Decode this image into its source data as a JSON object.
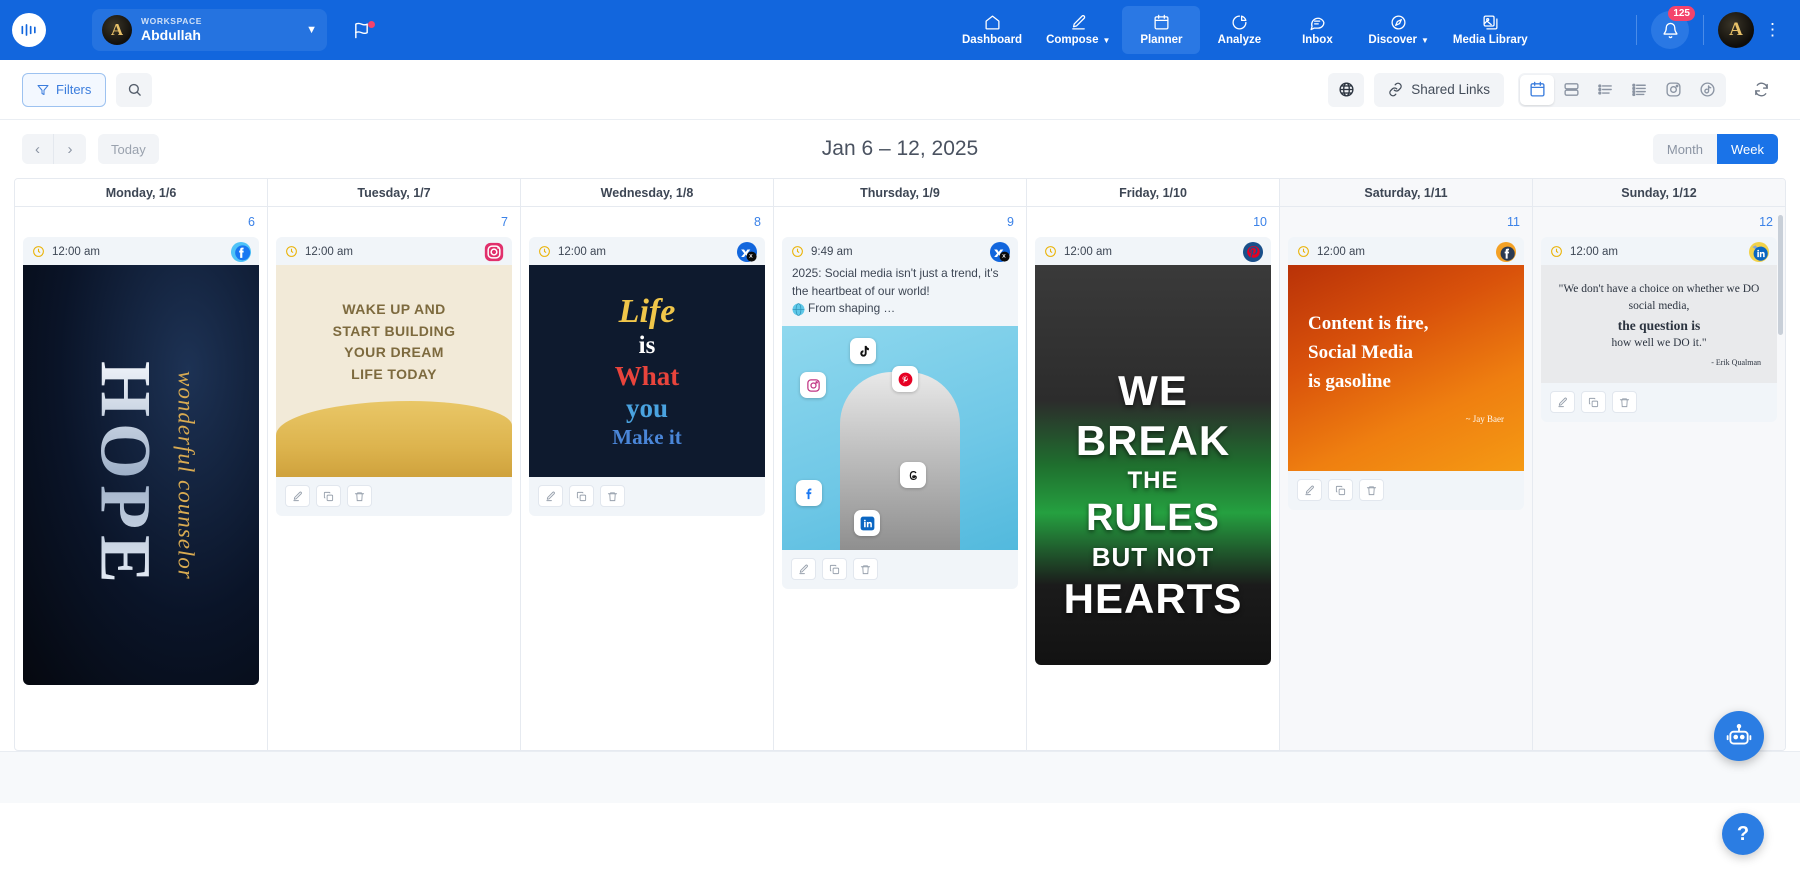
{
  "topnav": {
    "brand_icon": "hootsuite-logo-icon",
    "workspace": {
      "label": "WORKSPACE",
      "name": "Abdullah",
      "avatar_initial": "A",
      "caret_icon": "chevron-down-icon"
    },
    "flag_icon": "flag-icon",
    "items": [
      {
        "label": "Dashboard",
        "icon": "home-icon",
        "active": false,
        "caret": false
      },
      {
        "label": "Compose",
        "icon": "pencil-icon",
        "active": false,
        "caret": true
      },
      {
        "label": "Planner",
        "icon": "calendar-icon",
        "active": true,
        "caret": false
      },
      {
        "label": "Analyze",
        "icon": "pie-chart-icon",
        "active": false,
        "caret": false
      },
      {
        "label": "Inbox",
        "icon": "message-icon",
        "active": false,
        "caret": false
      },
      {
        "label": "Discover",
        "icon": "compass-icon",
        "active": false,
        "caret": true
      },
      {
        "label": "Media Library",
        "icon": "image-stack-icon",
        "active": false,
        "caret": false
      }
    ],
    "notifications": {
      "icon": "bell-icon",
      "count": "125"
    },
    "user_avatar_initial": "A",
    "kebab_icon": "more-vertical-icon"
  },
  "toolbar": {
    "filters_label": "Filters",
    "filters_icon": "filter-icon",
    "search_icon": "search-icon",
    "globe_icon": "globe-icon",
    "shared_links_label": "Shared Links",
    "shared_links_icon": "link-icon",
    "views": [
      {
        "icon": "calendar-view-icon",
        "name": "calendar-view",
        "active": true
      },
      {
        "icon": "split-view-icon",
        "name": "split-view",
        "active": false
      },
      {
        "icon": "list-view-icon",
        "name": "list-view",
        "active": false
      },
      {
        "icon": "detail-list-view-icon",
        "name": "detail-list-view",
        "active": false
      },
      {
        "icon": "instagram-icon",
        "name": "instagram-view",
        "active": false
      },
      {
        "icon": "tiktok-icon",
        "name": "tiktok-view",
        "active": false
      }
    ],
    "refresh_icon": "refresh-icon"
  },
  "datebar": {
    "prev_icon": "chevron-left-icon",
    "next_icon": "chevron-right-icon",
    "today_label": "Today",
    "range": "Jan 6 – 12, 2025",
    "month_label": "Month",
    "week_label": "Week",
    "active_view": "Week"
  },
  "calendar": {
    "days": [
      {
        "header": "Monday, 1/6",
        "number": "6",
        "weekend": false,
        "post": {
          "time": "12:00 am",
          "clock_icon": "clock-icon",
          "channel": "facebook",
          "channel_icon": "facebook-icon",
          "text": "",
          "media": "hope-wonderful-counselor-image",
          "media_lines": {
            "word": "HOPE",
            "sub": "wonderful counselor"
          },
          "actions_visible": false
        }
      },
      {
        "header": "Tuesday, 1/7",
        "number": "7",
        "weekend": false,
        "post": {
          "time": "12:00 am",
          "clock_icon": "clock-icon",
          "channel": "instagram",
          "channel_icon": "instagram-icon",
          "text": "",
          "media": "wake-up-and-start-building-image",
          "media_lines": {
            "l1": "WAKE UP AND",
            "l2": "START BUILDING",
            "l3": "YOUR DREAM",
            "l4": "LIFE TODAY"
          },
          "actions_visible": true
        }
      },
      {
        "header": "Wednesday, 1/8",
        "number": "8",
        "weekend": false,
        "post": {
          "time": "12:00 am",
          "clock_icon": "clock-icon",
          "channel": "x",
          "channel_icon": "x-twitter-icon",
          "text": "",
          "media": "life-is-what-you-make-it-image",
          "media_lines": {
            "l1": "Life",
            "l2": "is",
            "l3": "What",
            "l4": "you",
            "l5": "Make it"
          },
          "actions_visible": true
        }
      },
      {
        "header": "Thursday, 1/9",
        "number": "9",
        "weekend": false,
        "post": {
          "time": "9:49 am",
          "clock_icon": "clock-icon",
          "channel": "x",
          "channel_icon": "x-twitter-icon",
          "text_a": "2025: Social media isn't just a trend, it's the heartbeat of our world!",
          "text_emoji": "globe-emoji",
          "text_b": "From shaping …",
          "media": "social-media-collage-image",
          "actions_visible": true
        }
      },
      {
        "header": "Friday, 1/10",
        "number": "10",
        "weekend": false,
        "post": {
          "time": "12:00 am",
          "clock_icon": "clock-icon",
          "channel": "pinterest",
          "channel_icon": "pinterest-icon",
          "text": "",
          "media": "we-break-the-rules-but-not-hearts-image",
          "media_lines": {
            "r1": "WE",
            "r2": "BREAK",
            "r3": "THE",
            "r4": "RULES",
            "r5": "BUT NOT",
            "r6": "HEARTS"
          },
          "actions_visible": false
        }
      },
      {
        "header": "Saturday, 1/11",
        "number": "11",
        "weekend": true,
        "post": {
          "time": "12:00 am",
          "clock_icon": "clock-icon",
          "channel": "facebook",
          "channel_icon": "facebook-icon",
          "text": "",
          "media": "content-is-fire-social-media-is-gasoline-image",
          "media_lines": {
            "f1": "Content is fire,",
            "f2": "Social Media",
            "f3": "is gasoline",
            "f4": "~ Jay Baer"
          },
          "actions_visible": true
        }
      },
      {
        "header": "Sunday, 1/12",
        "number": "12",
        "weekend": true,
        "post": {
          "time": "12:00 am",
          "clock_icon": "clock-icon",
          "channel": "linkedin",
          "channel_icon": "linkedin-icon",
          "text": "",
          "media": "erik-qualman-quote-image",
          "media_lines": {
            "q1": "\"We don't have a choice on whether we DO social media,",
            "q2": "the question is",
            "q3": "how well we DO it.\"",
            "q4": "- Erik Qualman"
          },
          "actions_visible": true
        }
      }
    ],
    "card_actions": [
      {
        "name": "edit-post-button",
        "icon": "pencil-icon"
      },
      {
        "name": "duplicate-post-button",
        "icon": "copy-icon"
      },
      {
        "name": "delete-post-button",
        "icon": "trash-icon"
      }
    ]
  },
  "fab": {
    "bot_icon": "robot-assistant-icon",
    "help_label": "?"
  },
  "colors": {
    "brand_blue": "#1266dd",
    "accent_blue": "#3b7ddd",
    "badge_red": "#f4436c",
    "clock_yellow": "#eab308"
  }
}
